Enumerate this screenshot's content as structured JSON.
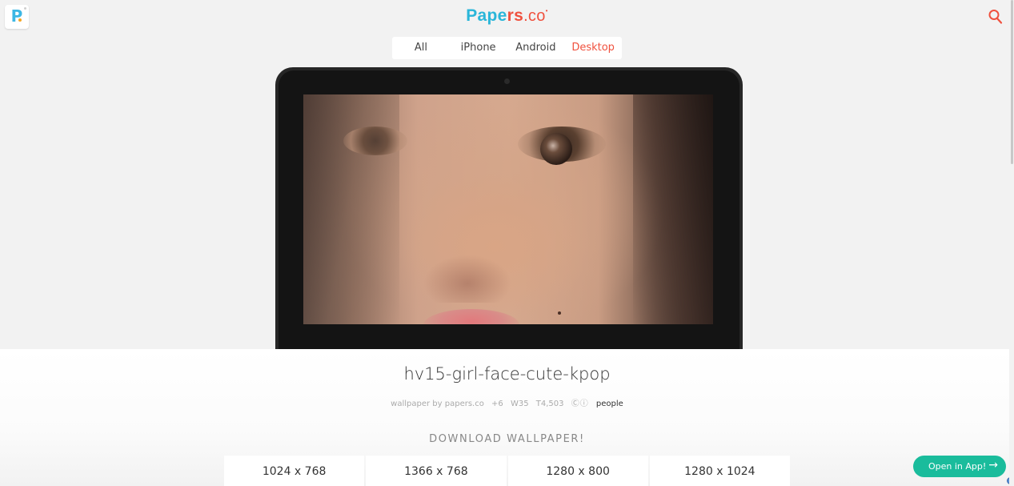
{
  "brand": {
    "part1": "Pape",
    "part2": "rs",
    "part3": ".co"
  },
  "logo": {
    "letter": "P"
  },
  "tabs": [
    {
      "label": "All",
      "active": false
    },
    {
      "label": "iPhone",
      "active": false
    },
    {
      "label": "Android",
      "active": false
    },
    {
      "label": "Desktop",
      "active": true
    }
  ],
  "wallpaper": {
    "title": "hv15-girl-face-cute-kpop",
    "credit": "wallpaper by papers.co",
    "plus": "+6",
    "w_count": "W35",
    "t_count": "T4,503",
    "license_icons": "Ⓒⓘ",
    "tag": "people"
  },
  "download": {
    "heading": "DOWNLOAD WALLPAPER!",
    "sizes": [
      "1024 x 768",
      "1366 x 768",
      "1280 x 800",
      "1280 x 1024"
    ]
  },
  "app_button": {
    "label": "Open in App!",
    "arrow": "→"
  },
  "colors": {
    "accent": "#f0513e",
    "brand_blue": "#2ab6d9",
    "app_green": "#1abc9c",
    "laptop": "#262626"
  },
  "icons": [
    "search-icon",
    "arrow-right-icon",
    "camera-icon"
  ]
}
